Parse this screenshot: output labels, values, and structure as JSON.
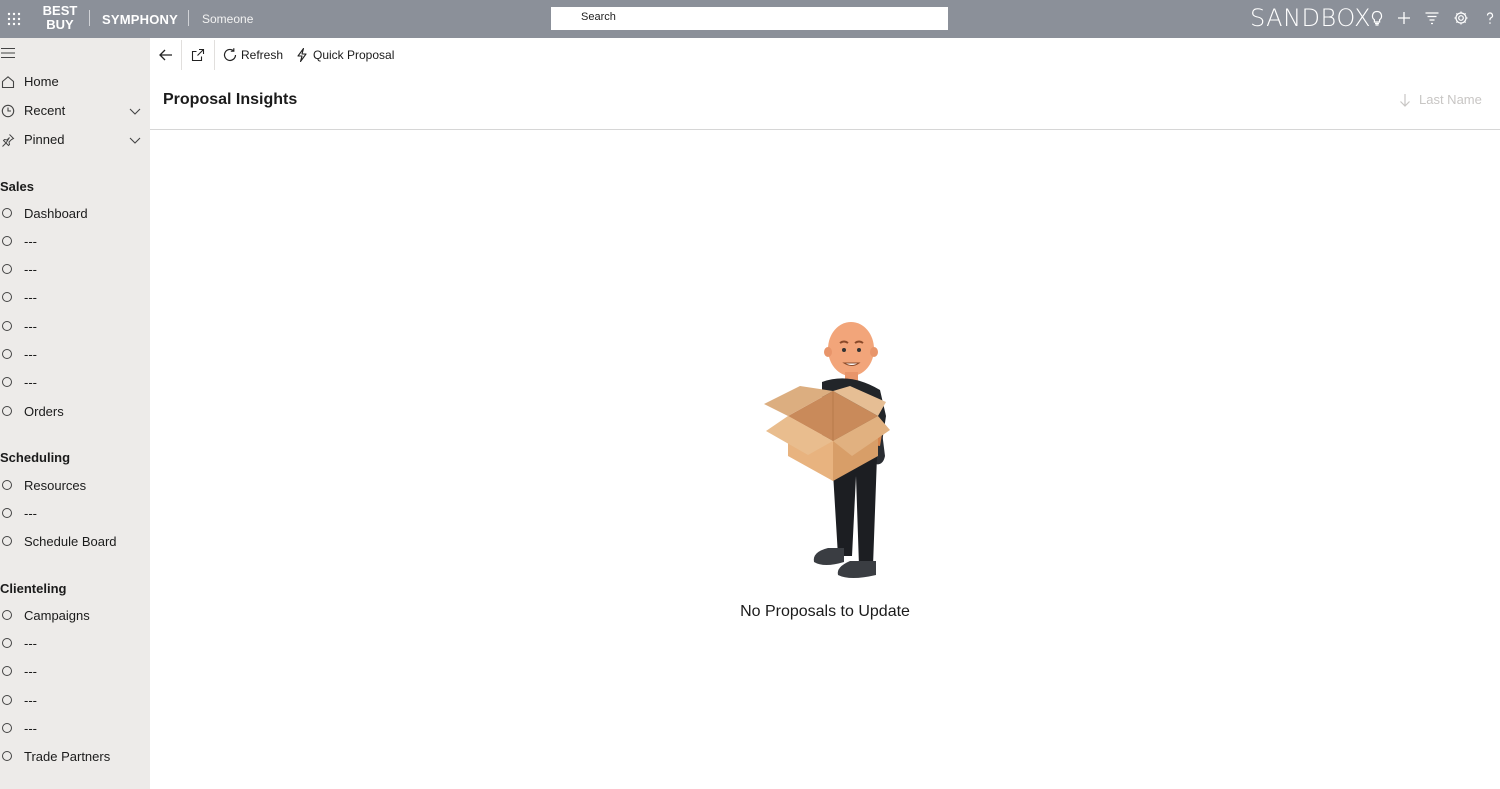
{
  "topbar": {
    "brand_line1": "BEST",
    "brand_line2": "BUY",
    "app_name": "SYMPHONY",
    "user_name": "Someone",
    "search_placeholder": "Search",
    "environment": "SANDBOX"
  },
  "sidebar": {
    "top_items": [
      {
        "label": "Home"
      },
      {
        "label": "Recent"
      },
      {
        "label": "Pinned"
      }
    ],
    "sections": [
      {
        "title": "Sales",
        "items": [
          "Dashboard",
          "---",
          "---",
          "---",
          "---",
          "---",
          "---",
          "Orders"
        ]
      },
      {
        "title": "Scheduling",
        "items": [
          "Resources",
          "---",
          "Schedule Board"
        ]
      },
      {
        "title": "Clienteling",
        "items": [
          "Campaigns",
          "---",
          "---",
          "---",
          "---",
          "Trade Partners"
        ]
      }
    ]
  },
  "commandbar": {
    "refresh_label": "Refresh",
    "quick_proposal_label": "Quick Proposal"
  },
  "main": {
    "title": "Proposal Insights",
    "sort_label": "Last Name",
    "empty_message": "No Proposals to Update"
  }
}
